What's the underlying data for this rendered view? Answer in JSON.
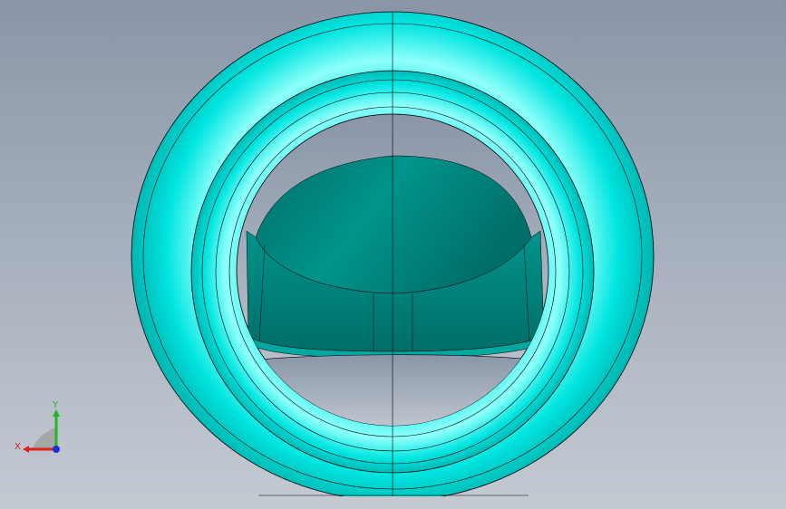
{
  "colors": {
    "background_top": "#8a96a8",
    "background_bottom": "#c4cad2",
    "part_face": "#00e5e0",
    "part_highlight": "#8ffffb",
    "part_shadow": "#00b2ae",
    "inner_face_dark": "#006e68",
    "inner_face_mid": "#00948c",
    "edge": "#000000",
    "x_axis": "#e0201c",
    "y_axis": "#1fb81f",
    "z_axis": "#1c2ed8"
  },
  "orientation_triad": {
    "x_label": "X",
    "y_label": "Y"
  }
}
